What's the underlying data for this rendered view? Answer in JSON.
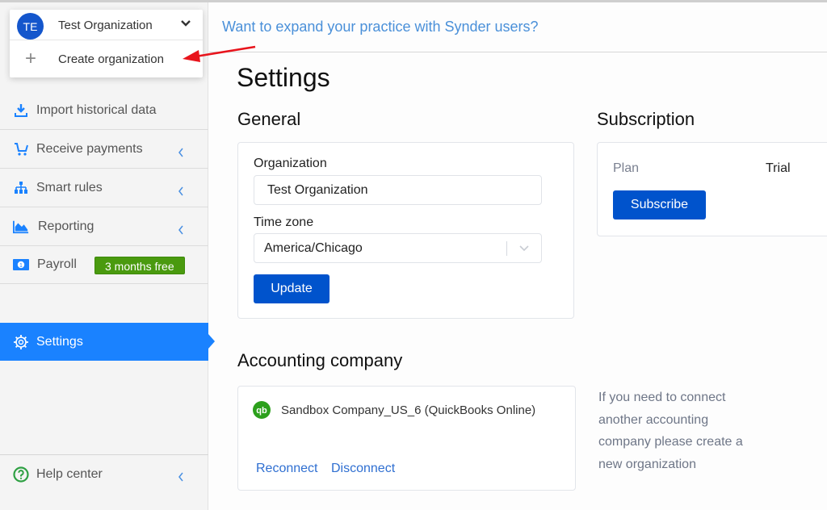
{
  "org_dropdown": {
    "avatar_initials": "TE",
    "selected_org": "Test Organization",
    "create_label": "Create organization"
  },
  "header": {
    "promo_link": "Want to expand your practice with Synder users?"
  },
  "sidebar": {
    "items": [
      {
        "label": "Import historical data",
        "icon": "download-icon"
      },
      {
        "label": "Receive payments",
        "icon": "cart-icon"
      },
      {
        "label": "Smart rules",
        "icon": "hierarchy-icon"
      },
      {
        "label": "Reporting",
        "icon": "area-chart-icon"
      },
      {
        "label": "Payroll",
        "icon": "money-icon",
        "badge": "3 months free"
      },
      {
        "label": "Settings",
        "icon": "gear-icon",
        "active": true
      },
      {
        "label": "Help center",
        "icon": "help-icon"
      }
    ]
  },
  "main": {
    "page_title": "Settings",
    "general": {
      "title": "General",
      "organization_label": "Organization",
      "organization_value": "Test Organization",
      "timezone_label": "Time zone",
      "timezone_value": "America/Chicago",
      "update_button": "Update"
    },
    "subscription": {
      "title": "Subscription",
      "plan_label": "Plan",
      "plan_value": "Trial",
      "subscribe_button": "Subscribe"
    },
    "accounting": {
      "title": "Accounting company",
      "company_name": "Sandbox Company_US_6 (QuickBooks Online)",
      "reconnect": "Reconnect",
      "disconnect": "Disconnect",
      "note": "If you need to connect another accounting company please create a new organization"
    }
  },
  "colors": {
    "accent": "#1a82ff",
    "primary_button": "#0053cc",
    "badge_green": "#4a9a0f",
    "annotation_arrow": "#e8141c"
  }
}
